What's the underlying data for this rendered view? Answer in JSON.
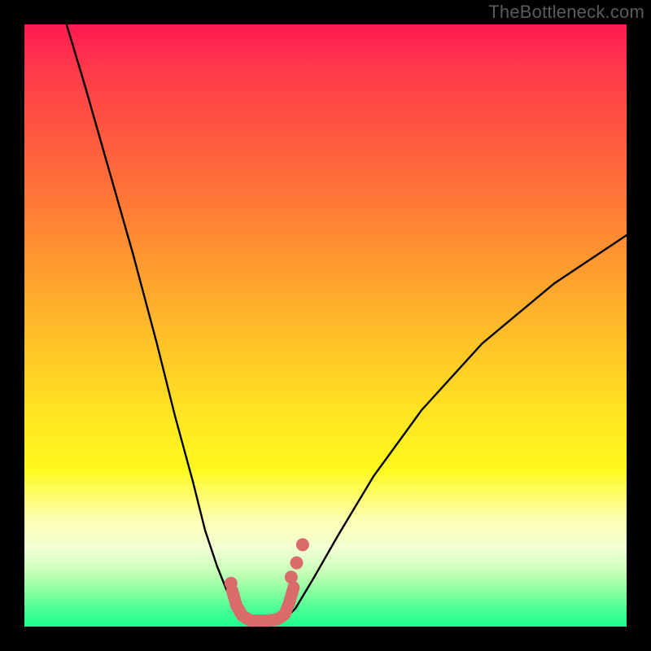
{
  "watermark": "TheBottleneck.com",
  "colors": {
    "frame_bg": "#000000",
    "curve": "#000000",
    "overlay_stroke": "#d96b6b",
    "overlay_fill": "#d96b6b",
    "gradient_top": "#ff1a53",
    "gradient_bottom": "#1eff8e"
  },
  "chart_data": {
    "type": "line",
    "title": "",
    "xlabel": "",
    "ylabel": "",
    "xlim": [
      0,
      100
    ],
    "ylim": [
      0,
      100
    ],
    "series": [
      {
        "name": "left-curve",
        "x": [
          7,
          10,
          14,
          18,
          22,
          25,
          28,
          30,
          32,
          34,
          35.5,
          37
        ],
        "y": [
          100,
          90,
          76,
          62,
          47,
          35,
          24,
          16,
          10,
          5,
          2.5,
          1
        ]
      },
      {
        "name": "right-curve",
        "x": [
          43,
          45,
          48,
          52,
          58,
          66,
          76,
          88,
          100
        ],
        "y": [
          1,
          3,
          8,
          15,
          25,
          36,
          47,
          57,
          65
        ]
      },
      {
        "name": "bottom-overlay-path",
        "x": [
          34.5,
          35.2,
          36.2,
          37.5,
          39,
          40.5,
          42,
          43.2,
          44,
          44.7
        ],
        "y": [
          6,
          3.5,
          1.8,
          1,
          1,
          1,
          1.2,
          2,
          4,
          6.5
        ]
      }
    ],
    "overlay_dots": [
      {
        "x": 34.3,
        "y": 7.2
      },
      {
        "x": 44.3,
        "y": 8.2
      },
      {
        "x": 45.2,
        "y": 10.6
      },
      {
        "x": 46.2,
        "y": 13.6
      }
    ],
    "gradient_stops": [
      {
        "pct": 0,
        "color": "#ff1a53"
      },
      {
        "pct": 8,
        "color": "#ff3b4a"
      },
      {
        "pct": 18,
        "color": "#ff5740"
      },
      {
        "pct": 30,
        "color": "#ff7a36"
      },
      {
        "pct": 42,
        "color": "#ffa12e"
      },
      {
        "pct": 54,
        "color": "#ffc627"
      },
      {
        "pct": 66,
        "color": "#ffe821"
      },
      {
        "pct": 74,
        "color": "#fff91e"
      },
      {
        "pct": 82,
        "color": "#fdffb0"
      },
      {
        "pct": 87,
        "color": "#f2ffd4"
      },
      {
        "pct": 91,
        "color": "#c7ffb8"
      },
      {
        "pct": 94,
        "color": "#8effa0"
      },
      {
        "pct": 97,
        "color": "#4cff95"
      },
      {
        "pct": 100,
        "color": "#1eff8e"
      }
    ]
  }
}
